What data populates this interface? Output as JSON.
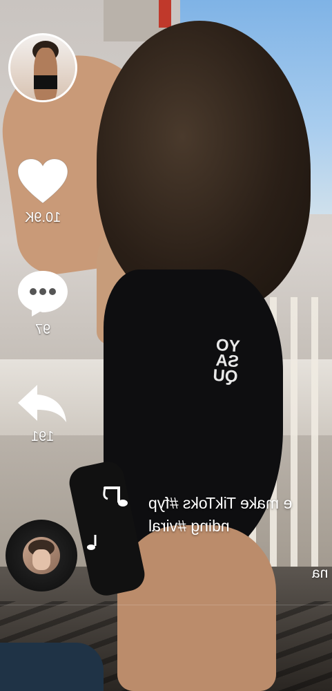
{
  "app": {
    "name": "TikTok"
  },
  "actions": {
    "like": {
      "count": "10.9K",
      "icon": "heart-icon"
    },
    "comment": {
      "count": "97",
      "icon": "comment-bubble-icon"
    },
    "share": {
      "count": "191",
      "icon": "share-arrow-icon"
    }
  },
  "caption": {
    "line1": "e make TikToks #fyp",
    "line2": "nding #viral"
  },
  "sound": {
    "text": "na",
    "icon": "music-note-icon"
  },
  "colors": {
    "icon_fill": "#ffffff",
    "overlay_text": "#ffffff"
  },
  "video": {
    "print_text": "YO\nSA\nQU"
  }
}
